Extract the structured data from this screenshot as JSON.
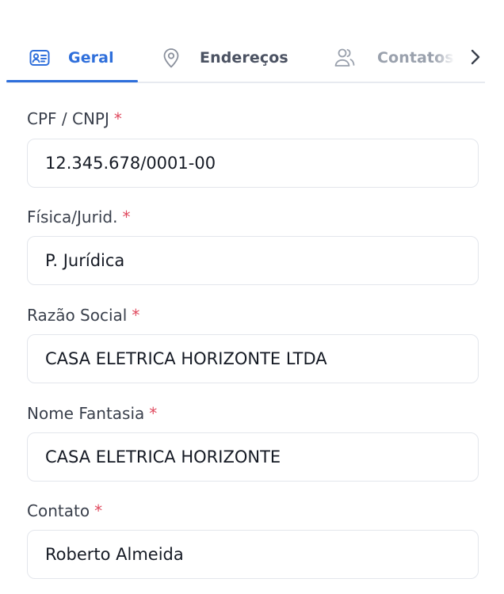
{
  "tabs": {
    "items": [
      {
        "label": "Geral",
        "icon": "id-card-icon",
        "active": true
      },
      {
        "label": "Endereços",
        "icon": "map-pin-icon",
        "active": false
      },
      {
        "label": "Contatos",
        "icon": "users-icon",
        "active": false
      }
    ],
    "next_icon": "chevron-right-icon"
  },
  "colors": {
    "accent": "#2f6fdb",
    "required": "#e04a5f",
    "border": "#e3e6ec"
  },
  "form": {
    "required_mark": "*",
    "fields": [
      {
        "label": "CPF / CNPJ",
        "value": "12.345.678/0001-00",
        "required": true
      },
      {
        "label": "Física/Jurid.",
        "value": "P. Jurídica",
        "required": true
      },
      {
        "label": "Razão Social",
        "value": "CASA ELETRICA HORIZONTE LTDA",
        "required": true
      },
      {
        "label": "Nome Fantasia",
        "value": "CASA ELETRICA HORIZONTE",
        "required": true
      },
      {
        "label": "Contato",
        "value": "Roberto Almeida",
        "required": true
      }
    ]
  }
}
